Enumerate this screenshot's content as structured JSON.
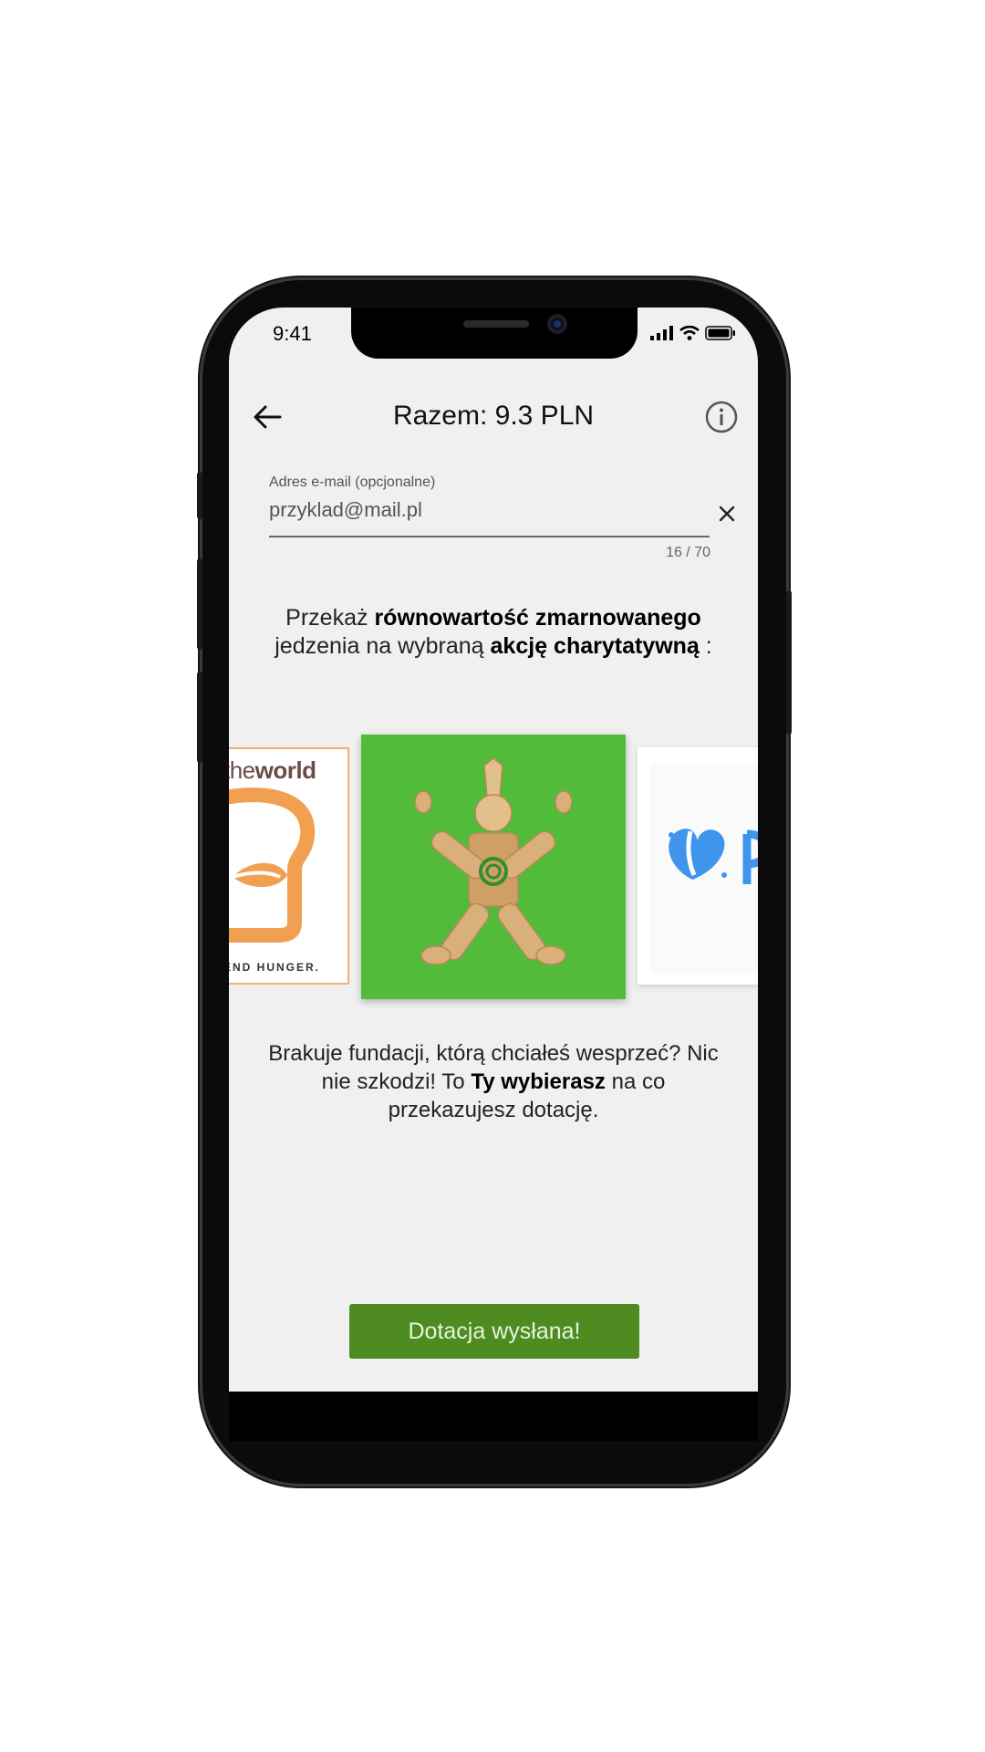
{
  "status_bar": {
    "time": "9:41"
  },
  "header": {
    "title": "Razem: 9.3 PLN"
  },
  "email": {
    "label": "Adres e-mail (opcjonalne)",
    "value": "przyklad@mail.pl",
    "counter": "16 / 70"
  },
  "intro": {
    "p1": "Przekaż ",
    "b1": "równowartość zmarnowanego",
    "p2": " jedzenia na wybraną ",
    "b2": "akcję charytatywną",
    "p3": " :"
  },
  "charities": {
    "left_logo_light": "the",
    "left_logo_bold": "world",
    "left_tagline": "END HUNGER."
  },
  "bottom_text": {
    "p1": "Brakuje fundacji, którą chciałeś wesprzeć? Nic nie szkodzi! To ",
    "b1": "Ty wybierasz",
    "p2": " na co przekazujesz dotację."
  },
  "donate_button": {
    "label": "Dotacja wysłana!"
  },
  "colors": {
    "accent": "#4e8c21",
    "screen_bg": "#f0f0f0",
    "card_green": "#52bb3a",
    "logo_orange": "#f0a050",
    "logo_blue": "#3f95ec"
  },
  "icons": [
    "back-arrow-icon",
    "info-icon",
    "close-icon",
    "signal-icon",
    "wifi-icon",
    "battery-icon"
  ]
}
